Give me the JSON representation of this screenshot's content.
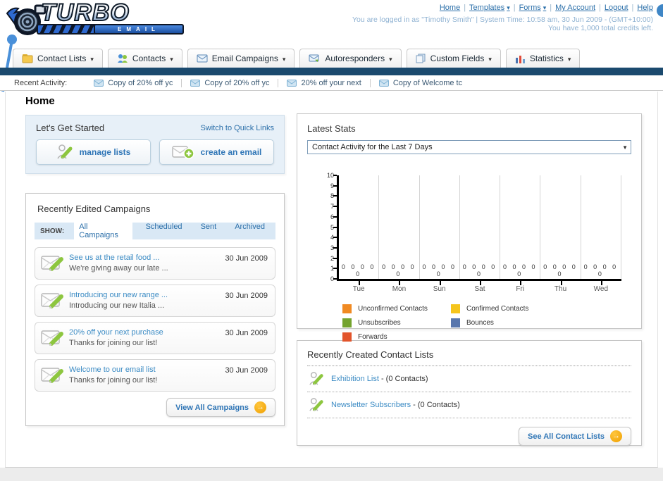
{
  "header": {
    "logo_title": "TURBO",
    "logo_subtitle": "EMAIL",
    "links": {
      "home": "Home",
      "templates": "Templates",
      "forms": "Forms",
      "my_account": "My Account",
      "logout": "Logout",
      "help": "Help"
    },
    "login_info": "You are logged in as \"Timothy Smith\" | System Time: 10:58 am, 30 Jun 2009 - (GMT+10:00)",
    "credits_info": "You have 1,000 total credits left."
  },
  "nav_tabs": {
    "contact_lists": "Contact Lists",
    "contacts": "Contacts",
    "email_campaigns": "Email Campaigns",
    "autoresponders": "Autoresponders",
    "custom_fields": "Custom Fields",
    "statistics": "Statistics"
  },
  "recent_activity": {
    "label": "Recent Activity:",
    "items": [
      {
        "text": "Copy of 20% off yc"
      },
      {
        "text": "Copy of 20% off yc"
      },
      {
        "text": "20% off your next"
      },
      {
        "text": "Copy of Welcome tc"
      }
    ]
  },
  "page": {
    "title": "Home"
  },
  "get_started": {
    "title": "Let's Get Started",
    "switch_link": "Switch to Quick Links",
    "manage_lists_label": "manage lists",
    "create_email_label": "create an email"
  },
  "campaigns": {
    "title": "Recently Edited Campaigns",
    "show_label": "SHOW:",
    "filters": [
      {
        "label": "All Campaigns",
        "bg": "#ffffff"
      },
      {
        "label": "Scheduled"
      },
      {
        "label": "Sent"
      },
      {
        "label": "Archived"
      }
    ],
    "items": [
      {
        "title": "See us at the retail food ...",
        "subtitle": "We're giving away our late ...",
        "date": "30 Jun 2009"
      },
      {
        "title": "Introducing our new range ...",
        "subtitle": "Introducing our new Italia ...",
        "date": "30 Jun 2009"
      },
      {
        "title": "20% off your next purchase",
        "subtitle": "Thanks for joining our list!",
        "date": "30 Jun 2009"
      },
      {
        "title": "Welcome to our email list",
        "subtitle": "Thanks for joining our list!",
        "date": "30 Jun 2009"
      }
    ],
    "view_all_label": "View All Campaigns"
  },
  "stats": {
    "title": "Latest Stats",
    "dropdown_value": "Contact Activity for the Last 7 Days"
  },
  "chart_data": {
    "type": "bar",
    "title": "Contact Activity for the Last 7 Days",
    "categories": [
      "Tue",
      "Mon",
      "Sun",
      "Sat",
      "Fri",
      "Thu",
      "Wed"
    ],
    "series": [
      {
        "name": "Unconfirmed Contacts",
        "color": "#f08a23",
        "values": [
          0,
          0,
          0,
          0,
          0,
          0,
          0
        ]
      },
      {
        "name": "Confirmed Contacts",
        "color": "#f5c51d",
        "values": [
          0,
          0,
          0,
          0,
          0,
          0,
          0
        ]
      },
      {
        "name": "Unsubscribes",
        "color": "#74a32e",
        "values": [
          0,
          0,
          0,
          0,
          0,
          0,
          0
        ]
      },
      {
        "name": "Bounces",
        "color": "#5977ad",
        "values": [
          0,
          0,
          0,
          0,
          0,
          0,
          0
        ]
      },
      {
        "name": "Forwards",
        "color": "#e2542b",
        "values": [
          0,
          0,
          0,
          0,
          0,
          0,
          0
        ]
      }
    ],
    "xlabel": "",
    "ylabel": "",
    "ylim": [
      0,
      10
    ],
    "yticks": [
      0,
      1,
      2,
      3,
      4,
      5,
      6,
      7,
      8,
      9,
      10
    ],
    "grid": true,
    "legend_position": "bottom"
  },
  "contact_lists": {
    "title": "Recently Created Contact Lists",
    "items": [
      {
        "name": "Exhibition List",
        "detail": "- (0 Contacts)"
      },
      {
        "name": "Newsletter Subscribers",
        "detail": "- (0 Contacts)"
      }
    ],
    "see_all_label": "See All Contact Lists"
  }
}
